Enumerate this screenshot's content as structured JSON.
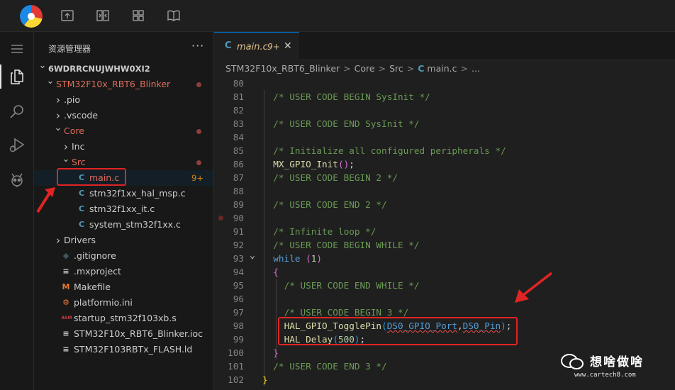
{
  "sidebar": {
    "title": "资源管理器",
    "more": "···",
    "rows": [
      {
        "label": "6WDRRCNUJWHW0XI2",
        "indent": 0,
        "chev": "down",
        "bold": true,
        "color": "#cccccc"
      },
      {
        "label": "STM32F10x_RBT6_Blinker",
        "indent": 1,
        "chev": "down",
        "color": "#e06c5a",
        "dot": true
      },
      {
        "label": ".pio",
        "indent": 2,
        "chev": "right",
        "color": "#cccccc"
      },
      {
        "label": ".vscode",
        "indent": 2,
        "chev": "right",
        "color": "#cccccc"
      },
      {
        "label": "Core",
        "indent": 2,
        "chev": "down",
        "color": "#e06c5a",
        "dot": true
      },
      {
        "label": "Inc",
        "indent": 3,
        "chev": "right",
        "color": "#cccccc"
      },
      {
        "label": "Src",
        "indent": 3,
        "chev": "down",
        "color": "#e06c5a",
        "dot": true
      },
      {
        "label": "main.c",
        "indent": 4,
        "icon": "C",
        "iconColor": "#519aba",
        "color": "#e06c5a",
        "badge": "9+",
        "selected": true
      },
      {
        "label": "stm32f1xx_hal_msp.c",
        "indent": 4,
        "icon": "C",
        "iconColor": "#519aba",
        "color": "#cccccc"
      },
      {
        "label": "stm32f1xx_it.c",
        "indent": 4,
        "icon": "C",
        "iconColor": "#519aba",
        "color": "#cccccc"
      },
      {
        "label": "system_stm32f1xx.c",
        "indent": 4,
        "icon": "C",
        "iconColor": "#519aba",
        "color": "#cccccc"
      },
      {
        "label": "Drivers",
        "indent": 2,
        "chev": "right",
        "color": "#cccccc"
      },
      {
        "label": ".gitignore",
        "indent": 2,
        "icon": "◆",
        "iconColor": "#41535b",
        "color": "#cccccc"
      },
      {
        "label": ".mxproject",
        "indent": 2,
        "icon": "≡",
        "iconColor": "#cccccc",
        "color": "#cccccc"
      },
      {
        "label": "Makefile",
        "indent": 2,
        "icon": "M",
        "iconColor": "#e37933",
        "color": "#cccccc"
      },
      {
        "label": "platformio.ini",
        "indent": 2,
        "icon": "⚙",
        "iconColor": "#e37933",
        "color": "#cccccc"
      },
      {
        "label": "startup_stm32f103xb.s",
        "indent": 2,
        "icon": "ASM",
        "iconColor": "#cc3e44",
        "color": "#cccccc"
      },
      {
        "label": "STM32F10x_RBT6_Blinker.ioc",
        "indent": 2,
        "icon": "≡",
        "iconColor": "#cccccc",
        "color": "#cccccc"
      },
      {
        "label": "STM32F103RBTx_FLASH.ld",
        "indent": 2,
        "icon": "≡",
        "iconColor": "#cccccc",
        "color": "#cccccc"
      }
    ]
  },
  "tab": {
    "icon": "C",
    "name": "main.c",
    "badge": "9+",
    "close": "✕"
  },
  "breadcrumb": [
    "STM32F10x_RBT6_Blinker",
    "Core",
    "Src",
    "main.c",
    "..."
  ],
  "breadcrumb_sep": ">",
  "breadcrumb_c": "C",
  "code": [
    {
      "n": "80",
      "t": []
    },
    {
      "n": "81",
      "t": [
        [
          "  ",
          ""
        ],
        [
          "/* USER CODE BEGIN SysInit */",
          "cm"
        ]
      ]
    },
    {
      "n": "82",
      "t": []
    },
    {
      "n": "83",
      "t": [
        [
          "  ",
          ""
        ],
        [
          "/* USER CODE END SysInit */",
          "cm"
        ]
      ]
    },
    {
      "n": "84",
      "t": []
    },
    {
      "n": "85",
      "t": [
        [
          "  ",
          ""
        ],
        [
          "/* Initialize all configured peripherals */",
          "cm"
        ]
      ]
    },
    {
      "n": "86",
      "t": [
        [
          "  ",
          ""
        ],
        [
          "MX_GPIO_Init",
          "fn"
        ],
        [
          "()",
          "br2"
        ],
        [
          ";",
          "pun"
        ]
      ]
    },
    {
      "n": "87",
      "t": [
        [
          "  ",
          ""
        ],
        [
          "/* USER CODE BEGIN 2 */",
          "cm"
        ]
      ]
    },
    {
      "n": "88",
      "t": []
    },
    {
      "n": "89",
      "t": [
        [
          "  ",
          ""
        ],
        [
          "/* USER CODE END 2 */",
          "cm"
        ]
      ]
    },
    {
      "n": "90",
      "t": [],
      "bp": true
    },
    {
      "n": "91",
      "t": [
        [
          "  ",
          ""
        ],
        [
          "/* Infinite loop */",
          "cm"
        ]
      ]
    },
    {
      "n": "92",
      "t": [
        [
          "  ",
          ""
        ],
        [
          "/* USER CODE BEGIN WHILE */",
          "cm"
        ]
      ]
    },
    {
      "n": "93",
      "t": [
        [
          "  ",
          ""
        ],
        [
          "while",
          "kw"
        ],
        [
          " ",
          ""
        ],
        [
          "(",
          "br2"
        ],
        [
          "1",
          "num"
        ],
        [
          ")",
          "br2"
        ]
      ],
      "fold": true
    },
    {
      "n": "94",
      "t": [
        [
          "  ",
          ""
        ],
        [
          "{",
          "br2"
        ]
      ]
    },
    {
      "n": "95",
      "t": [
        [
          "    ",
          ""
        ],
        [
          "/* USER CODE END WHILE */",
          "cm"
        ]
      ]
    },
    {
      "n": "96",
      "t": []
    },
    {
      "n": "97",
      "t": [
        [
          "    ",
          ""
        ],
        [
          "/* USER CODE BEGIN 3 */",
          "cm"
        ]
      ]
    },
    {
      "n": "98",
      "t": [
        [
          "    ",
          ""
        ],
        [
          "HAL_GPIO_TogglePin",
          "fn"
        ],
        [
          "(",
          "br3"
        ],
        [
          "DS0_GPIO_Port",
          "mac squig"
        ],
        [
          ",",
          "pun"
        ],
        [
          "DS0_Pin",
          "mac squig"
        ],
        [
          ")",
          "br3"
        ],
        [
          ";",
          "pun"
        ]
      ]
    },
    {
      "n": "99",
      "t": [
        [
          "    ",
          ""
        ],
        [
          "HAL_Delay",
          "fn"
        ],
        [
          "(",
          "br3"
        ],
        [
          "500",
          "num"
        ],
        [
          ")",
          "br3"
        ],
        [
          ";",
          "pun"
        ]
      ]
    },
    {
      "n": "100",
      "t": [
        [
          "  ",
          ""
        ],
        [
          "}",
          "br2"
        ]
      ]
    },
    {
      "n": "101",
      "t": [
        [
          "  ",
          ""
        ],
        [
          "/* USER CODE END 3 */",
          "cm"
        ]
      ]
    },
    {
      "n": "102",
      "t": [
        [
          "}",
          "br1"
        ]
      ]
    }
  ],
  "watermark": {
    "title": "想啥做啥",
    "url": "www.cartech8.com"
  },
  "colors": {
    "accent": "#0078d4",
    "annotation": "#e02424",
    "modified": "#e06c5a"
  }
}
